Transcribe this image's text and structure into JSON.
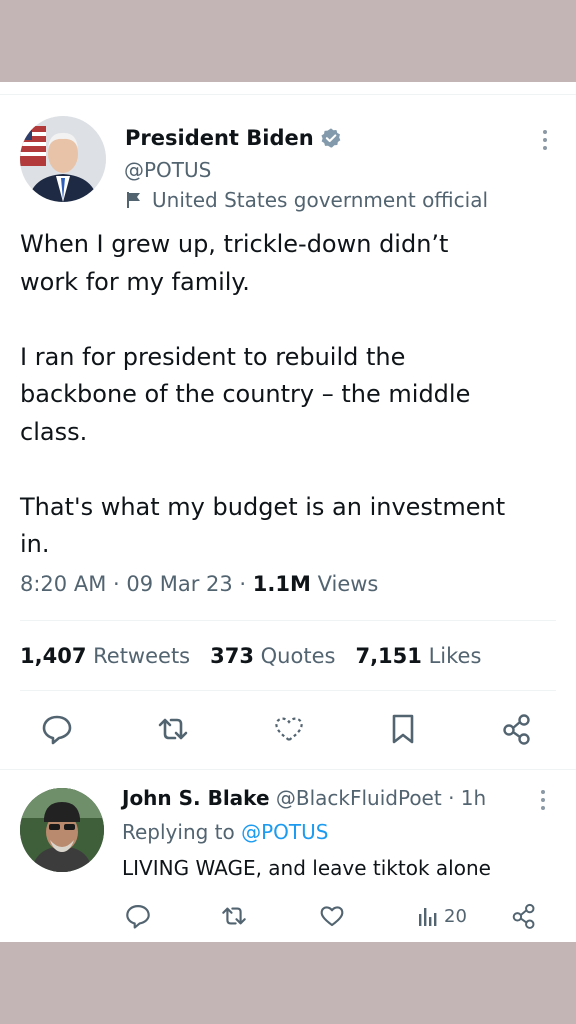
{
  "tweet": {
    "author_name": "President Biden",
    "author_handle": "@POTUS",
    "label": "United States government official",
    "text": "When I grew up, trickle-down didn’t\nwork for my family.\n\nI ran for president to rebuild the\nbackbone of the country – the middle\nclass.\n\nThat's what my budget is an investment\nin.",
    "time": "8:20 AM · 09 Mar 23 · ",
    "views_count": "1.1M",
    "views_label": " Views",
    "retweets_count": "1,407",
    "retweets_label": "Retweets",
    "quotes_count": "373",
    "quotes_label": "Quotes",
    "likes_count": "7,151",
    "likes_label": "Likes"
  },
  "reply": {
    "author_name": "John S. Blake",
    "author_handle": "@BlackFluidPoet · 1h",
    "replying_to_label": "Replying to ",
    "replying_to_handle": "@POTUS",
    "text": "LIVING WAGE,  and leave tiktok alone",
    "views_count": "20"
  },
  "colors": {
    "accent": "#1d9bf0",
    "verified": "#829aab",
    "muted_text": "#536471",
    "backdrop": "#c3b5b6"
  },
  "icons": [
    "verified-badge-icon",
    "flag-icon",
    "more-icon",
    "reply-icon",
    "retweet-icon",
    "like-icon",
    "bookmark-icon",
    "share-icon",
    "views-icon"
  ]
}
